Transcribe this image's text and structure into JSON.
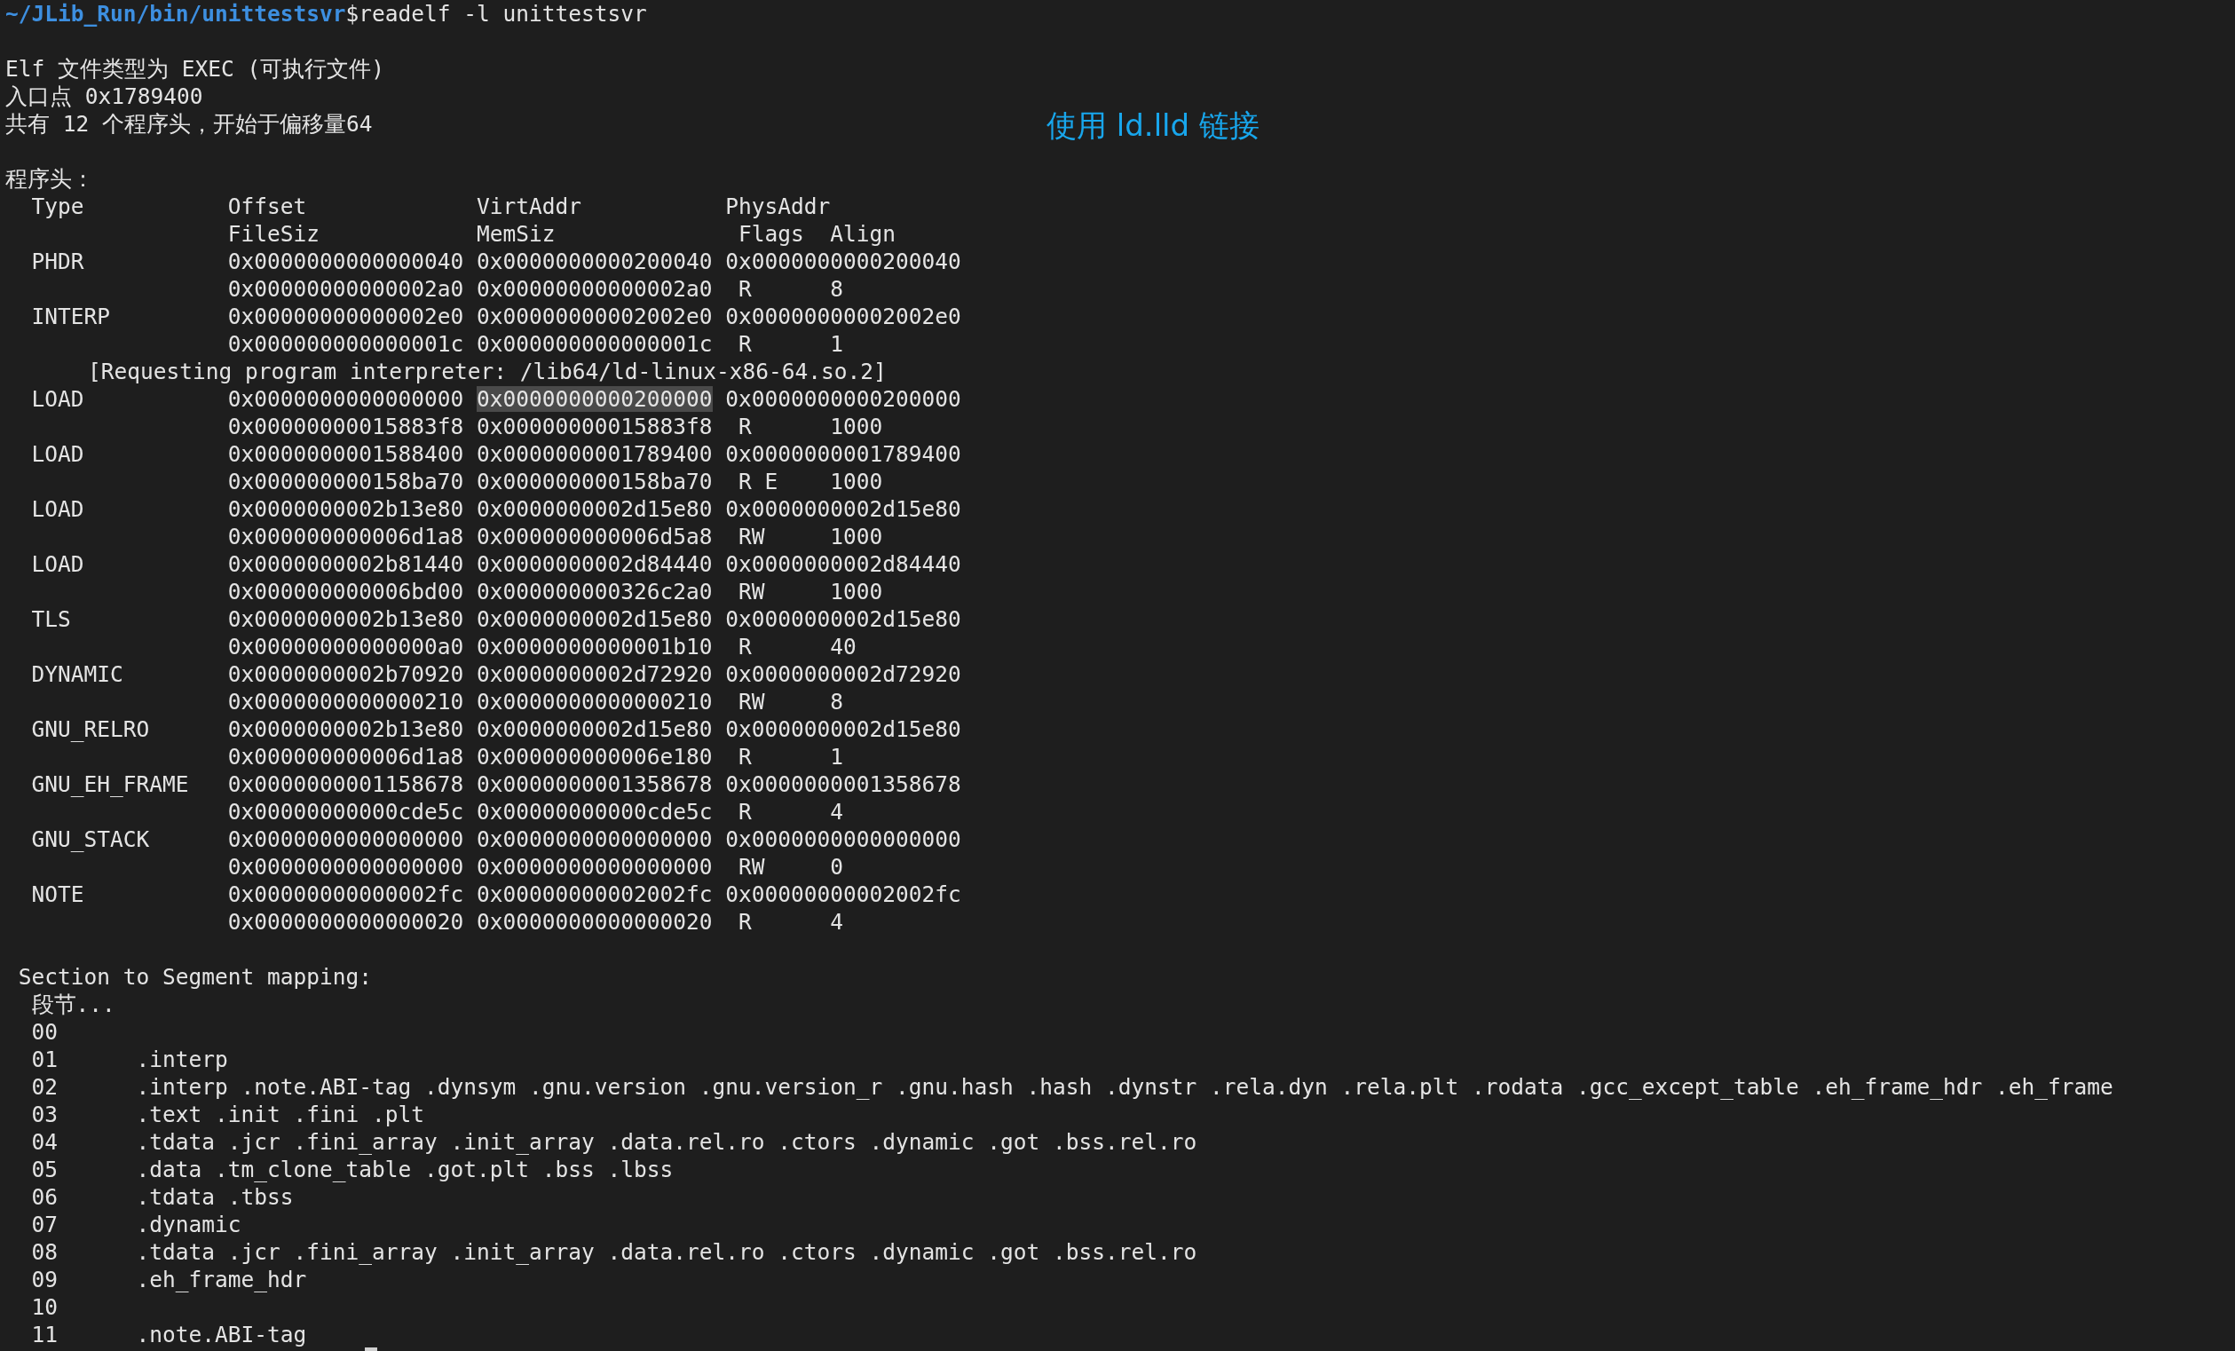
{
  "prompt": {
    "path": "~/JLib_Run/bin/unittestsvr",
    "symbol": "$",
    "command": "readelf -l unittestsvr"
  },
  "summary": [
    "Elf 文件类型为 EXEC (可执行文件)",
    "入口点 0x1789400",
    "共有 12 个程序头，开始于偏移量64"
  ],
  "annotation": "使用 ld.lld 链接",
  "program_headers": {
    "title": "程序头：",
    "header_row_1": [
      "Type",
      "Offset",
      "VirtAddr",
      "PhysAddr"
    ],
    "header_row_2": [
      "FileSiz",
      "MemSiz",
      "Flags",
      "Align"
    ],
    "entries": [
      {
        "type": "PHDR",
        "offset": "0x0000000000000040",
        "virtaddr": "0x0000000000200040",
        "physaddr": "0x0000000000200040",
        "filesiz": "0x00000000000002a0",
        "memsiz": "0x00000000000002a0",
        "flags": "R",
        "align": "8",
        "virtaddr_selected": false
      },
      {
        "type": "INTERP",
        "offset": "0x00000000000002e0",
        "virtaddr": "0x00000000002002e0",
        "physaddr": "0x00000000002002e0",
        "filesiz": "0x000000000000001c",
        "memsiz": "0x000000000000001c",
        "flags": "R",
        "align": "1",
        "virtaddr_selected": false,
        "note": "[Requesting program interpreter: /lib64/ld-linux-x86-64.so.2]"
      },
      {
        "type": "LOAD",
        "offset": "0x0000000000000000",
        "virtaddr": "0x0000000000200000",
        "physaddr": "0x0000000000200000",
        "filesiz": "0x00000000015883f8",
        "memsiz": "0x00000000015883f8",
        "flags": "R",
        "align": "1000",
        "virtaddr_selected": true
      },
      {
        "type": "LOAD",
        "offset": "0x0000000001588400",
        "virtaddr": "0x0000000001789400",
        "physaddr": "0x0000000001789400",
        "filesiz": "0x000000000158ba70",
        "memsiz": "0x000000000158ba70",
        "flags": "R E",
        "align": "1000",
        "virtaddr_selected": false
      },
      {
        "type": "LOAD",
        "offset": "0x0000000002b13e80",
        "virtaddr": "0x0000000002d15e80",
        "physaddr": "0x0000000002d15e80",
        "filesiz": "0x000000000006d1a8",
        "memsiz": "0x000000000006d5a8",
        "flags": "RW",
        "align": "1000",
        "virtaddr_selected": false
      },
      {
        "type": "LOAD",
        "offset": "0x0000000002b81440",
        "virtaddr": "0x0000000002d84440",
        "physaddr": "0x0000000002d84440",
        "filesiz": "0x000000000006bd00",
        "memsiz": "0x000000000326c2a0",
        "flags": "RW",
        "align": "1000",
        "virtaddr_selected": false
      },
      {
        "type": "TLS",
        "offset": "0x0000000002b13e80",
        "virtaddr": "0x0000000002d15e80",
        "physaddr": "0x0000000002d15e80",
        "filesiz": "0x00000000000000a0",
        "memsiz": "0x0000000000001b10",
        "flags": "R",
        "align": "40",
        "virtaddr_selected": false
      },
      {
        "type": "DYNAMIC",
        "offset": "0x0000000002b70920",
        "virtaddr": "0x0000000002d72920",
        "physaddr": "0x0000000002d72920",
        "filesiz": "0x0000000000000210",
        "memsiz": "0x0000000000000210",
        "flags": "RW",
        "align": "8",
        "virtaddr_selected": false
      },
      {
        "type": "GNU_RELRO",
        "offset": "0x0000000002b13e80",
        "virtaddr": "0x0000000002d15e80",
        "physaddr": "0x0000000002d15e80",
        "filesiz": "0x000000000006d1a8",
        "memsiz": "0x000000000006e180",
        "flags": "R",
        "align": "1",
        "virtaddr_selected": false
      },
      {
        "type": "GNU_EH_FRAME",
        "offset": "0x0000000001158678",
        "virtaddr": "0x0000000001358678",
        "physaddr": "0x0000000001358678",
        "filesiz": "0x00000000000cde5c",
        "memsiz": "0x00000000000cde5c",
        "flags": "R",
        "align": "4",
        "virtaddr_selected": false
      },
      {
        "type": "GNU_STACK",
        "offset": "0x0000000000000000",
        "virtaddr": "0x0000000000000000",
        "physaddr": "0x0000000000000000",
        "filesiz": "0x0000000000000000",
        "memsiz": "0x0000000000000000",
        "flags": "RW",
        "align": "0",
        "virtaddr_selected": false
      },
      {
        "type": "NOTE",
        "offset": "0x00000000000002fc",
        "virtaddr": "0x00000000002002fc",
        "physaddr": "0x00000000002002fc",
        "filesiz": "0x0000000000000020",
        "memsiz": "0x0000000000000020",
        "flags": "R",
        "align": "4",
        "virtaddr_selected": false
      }
    ]
  },
  "mapping": {
    "title": "Section to Segment mapping:",
    "header": "段节...",
    "segments": [
      {
        "number": "00"
      },
      {
        "number": "01",
        "sections": ".interp"
      },
      {
        "number": "02",
        "sections": ".interp .note.ABI-tag .dynsym .gnu.version .gnu.version_r .gnu.hash .hash .dynstr .rela.dyn .rela.plt .rodata .gcc_except_table .eh_frame_hdr .eh_frame"
      },
      {
        "number": "03",
        "sections": ".text .init .fini .plt"
      },
      {
        "number": "04",
        "sections": ".tdata .jcr .fini_array .init_array .data.rel.ro .ctors .dynamic .got .bss.rel.ro"
      },
      {
        "number": "05",
        "sections": ".data .tm_clone_table .got.plt .bss .lbss"
      },
      {
        "number": "06",
        "sections": ".tdata .tbss"
      },
      {
        "number": "07",
        "sections": ".dynamic"
      },
      {
        "number": "08",
        "sections": ".tdata .jcr .fini_array .init_array .data.rel.ro .ctors .dynamic .got .bss.rel.ro"
      },
      {
        "number": "09",
        "sections": ".eh_frame_hdr"
      },
      {
        "number": "10"
      },
      {
        "number": "11",
        "sections": ".note.ABI-tag"
      }
    ]
  }
}
